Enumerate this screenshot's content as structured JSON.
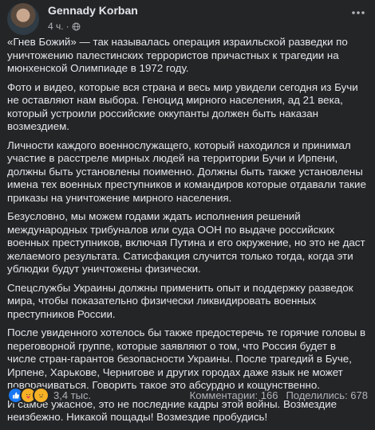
{
  "post": {
    "author": "Gennady Korban",
    "time": "4 ч.",
    "dot": "·",
    "more_icon": "more-dots-icon",
    "paragraphs": [
      "«Гнев Божий» — так называлась операция израильской разведки по уничтожению палестинских террористов причастных к трагедии на мюнхенской Олимпиаде в 1972 году.",
      "Фото и видео, которые вся страна и весь мир увидели сегодня из Бучи не оставляют нам выбора. Геноцид мирного населения, ад 21 века, который устроили российские оккупанты должен быть наказан возмездием.",
      "Личности каждого военнослужащего, который находился и принимал участие в расстреле мирных людей на территории Бучи и Ирпени, должны быть установлены поименно. Должны быть также установлены имена тех военных преступников и командиров которые отдавали такие приказы на уничтожение мирного населения.",
      "Безусловно, мы можем годами ждать исполнения решений международных трибуналов или суда ООН по выдаче российских военных преступников, включая Путина и его окружение, но это не даст желаемого результата. Сатисфакция случится только тогда, когда эти ублюдки будут уничтожены физически.",
      "Спецслужбы Украины должны применить опыт и поддержку разведок мира, чтобы показательно физически ликвидировать военных преступников России.",
      "После увиденного хотелось бы также предостеречь те горячие головы в переговорной группе, которые заявляют о том, что Россия будет в числе стран-гарантов безопасности Украины. После трагедий в Буче, Ирпене, Харькове, Чернигове и других городах даже язык не может поворачиваться. Говорить такое это абсурдно и кощунственно.",
      "И самое ужасное, это не последние кадры этой войны. Возмездие неизбежно. Никакой пощады! Возмездие пробудись!"
    ],
    "reactions": {
      "icons": [
        "like-icon",
        "care-icon",
        "sad-icon"
      ],
      "count": "3,4 тыс."
    },
    "comments": "Комментарии: 166",
    "shares": "Поделились: 678"
  },
  "colors": {
    "background": "#242526",
    "text": "#e4e6eb",
    "secondary": "#b0b3b8",
    "like": "#1877f2"
  }
}
